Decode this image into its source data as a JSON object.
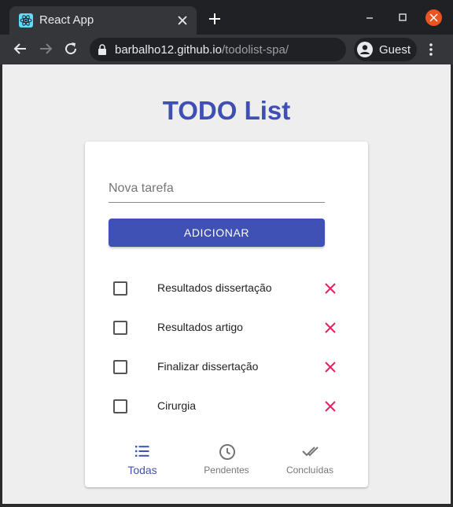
{
  "browser": {
    "tab_title": "React App",
    "url_host": "barbalho12.github.io",
    "url_path": "/todolist-spa/",
    "profile_label": "Guest"
  },
  "app": {
    "title": "TODO List",
    "input_placeholder": "Nova tarefa",
    "input_value": "",
    "add_label": "ADICIONAR",
    "tasks": [
      {
        "label": "Resultados dissertação",
        "done": false
      },
      {
        "label": "Resultados artigo",
        "done": false
      },
      {
        "label": "Finalizar dissertação",
        "done": false
      },
      {
        "label": "Cirurgia",
        "done": false
      }
    ],
    "filters": [
      {
        "label": "Todas",
        "icon": "list-icon",
        "active": true
      },
      {
        "label": "Pendentes",
        "icon": "clock-icon",
        "active": false
      },
      {
        "label": "Concluídas",
        "icon": "done-all-icon",
        "active": false
      }
    ]
  },
  "colors": {
    "primary": "#3f51b5",
    "title": "#3f4fb5",
    "delete": "#e91e63",
    "background": "#eeeeee"
  }
}
